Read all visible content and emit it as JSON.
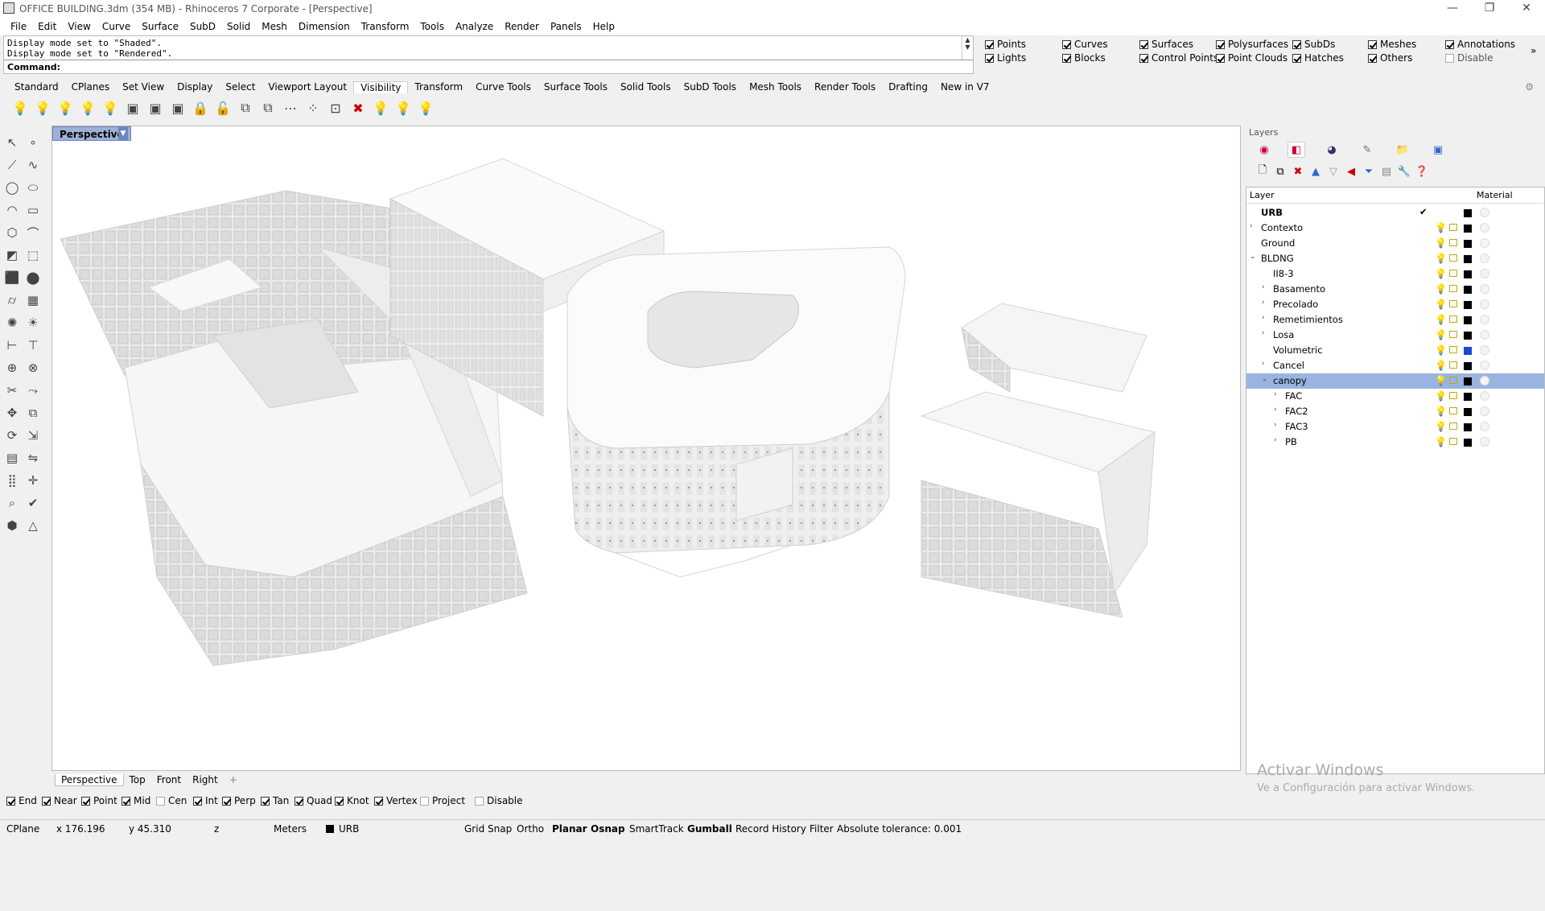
{
  "window": {
    "title": "OFFICE BUILDING.3dm (354 MB) - Rhinoceros 7 Corporate - [Perspective]",
    "minimize": "—",
    "maximize": "❐",
    "close": "✕"
  },
  "menu": [
    "File",
    "Edit",
    "View",
    "Curve",
    "Surface",
    "SubD",
    "Solid",
    "Mesh",
    "Dimension",
    "Transform",
    "Tools",
    "Analyze",
    "Render",
    "Panels",
    "Help"
  ],
  "command_history": [
    "Display mode set to \"Shaded\".",
    "Display mode set to \"Rendered\"."
  ],
  "command_label": "Command:",
  "selection_filter": [
    {
      "label": "Points",
      "checked": true
    },
    {
      "label": "Curves",
      "checked": true
    },
    {
      "label": "Surfaces",
      "checked": true
    },
    {
      "label": "Polysurfaces",
      "checked": true
    },
    {
      "label": "SubDs",
      "checked": true
    },
    {
      "label": "Meshes",
      "checked": true
    },
    {
      "label": "Annotations",
      "checked": true
    },
    {
      "label": "Lights",
      "checked": true
    },
    {
      "label": "Blocks",
      "checked": true
    },
    {
      "label": "Control Points",
      "checked": true
    },
    {
      "label": "Point Clouds",
      "checked": true
    },
    {
      "label": "Hatches",
      "checked": true
    },
    {
      "label": "Others",
      "checked": true
    },
    {
      "label": "Disable",
      "checked": false
    }
  ],
  "toolbar_tabs": [
    "Standard",
    "CPlanes",
    "Set View",
    "Display",
    "Select",
    "Viewport Layout",
    "Visibility",
    "Transform",
    "Curve Tools",
    "Surface Tools",
    "Solid Tools",
    "SubD Tools",
    "Mesh Tools",
    "Render Tools",
    "Drafting",
    "New in V7"
  ],
  "active_toolbar_tab": "Visibility",
  "viewport": {
    "label": "Perspective"
  },
  "viewport_tabs": [
    "Perspective",
    "Top",
    "Front",
    "Right"
  ],
  "viewport_tab_add": "+",
  "osnaps": [
    {
      "label": "End",
      "checked": true
    },
    {
      "label": "Near",
      "checked": true
    },
    {
      "label": "Point",
      "checked": true
    },
    {
      "label": "Mid",
      "checked": true
    },
    {
      "label": "Cen",
      "checked": false
    },
    {
      "label": "Int",
      "checked": true
    },
    {
      "label": "Perp",
      "checked": true
    },
    {
      "label": "Tan",
      "checked": true
    },
    {
      "label": "Quad",
      "checked": true
    },
    {
      "label": "Knot",
      "checked": true
    },
    {
      "label": "Vertex",
      "checked": true
    },
    {
      "label": "Project",
      "checked": false
    },
    {
      "label": "Disable",
      "checked": false
    }
  ],
  "status": {
    "cplane": "CPlane",
    "x": "x 176.196",
    "y": "y 45.310",
    "z": "z",
    "units": "Meters",
    "layer": "URB",
    "grid_snap": "Grid Snap",
    "ortho": "Ortho",
    "planar": "Planar",
    "osnap": "Osnap",
    "smarttrack": "SmartTrack",
    "gumball": "Gumball",
    "record_history": "Record History",
    "filter": "Filter",
    "tolerance": "Absolute tolerance: 0.001"
  },
  "layers_panel": {
    "title": "Layers",
    "col_layer": "Layer",
    "col_material": "Material",
    "rows": [
      {
        "name": "URB",
        "indent": 0,
        "expander": "",
        "bold": true,
        "current": true,
        "color": "#000000"
      },
      {
        "name": "Contexto",
        "indent": 0,
        "expander": "›",
        "color": "#000000"
      },
      {
        "name": "Ground",
        "indent": 0,
        "expander": "",
        "color": "#000000"
      },
      {
        "name": "BLDNG",
        "indent": 0,
        "expander": "⌄",
        "color": "#000000"
      },
      {
        "name": "II8-3",
        "indent": 1,
        "expander": "",
        "color": "#000000"
      },
      {
        "name": "Basamento",
        "indent": 1,
        "expander": "›",
        "color": "#000000"
      },
      {
        "name": "Precolado",
        "indent": 1,
        "expander": "›",
        "color": "#000000"
      },
      {
        "name": "Remetimientos",
        "indent": 1,
        "expander": "›",
        "color": "#000000"
      },
      {
        "name": "Losa",
        "indent": 1,
        "expander": "›",
        "color": "#000000"
      },
      {
        "name": "Volumetric",
        "indent": 1,
        "expander": "",
        "color": "#1c49d6"
      },
      {
        "name": "Cancel",
        "indent": 1,
        "expander": "›",
        "color": "#000000"
      },
      {
        "name": "canopy",
        "indent": 1,
        "expander": "⌄",
        "selected": true,
        "color": "#000000"
      },
      {
        "name": "FAC",
        "indent": 2,
        "expander": "›",
        "color": "#000000"
      },
      {
        "name": "FAC2",
        "indent": 2,
        "expander": "›",
        "color": "#000000"
      },
      {
        "name": "FAC3",
        "indent": 2,
        "expander": "›",
        "color": "#000000"
      },
      {
        "name": "PB",
        "indent": 2,
        "expander": "›",
        "color": "#000000"
      }
    ]
  },
  "watermark": {
    "line1": "Activar Windows",
    "line2": "Ve a Configuración para activar Windows."
  }
}
